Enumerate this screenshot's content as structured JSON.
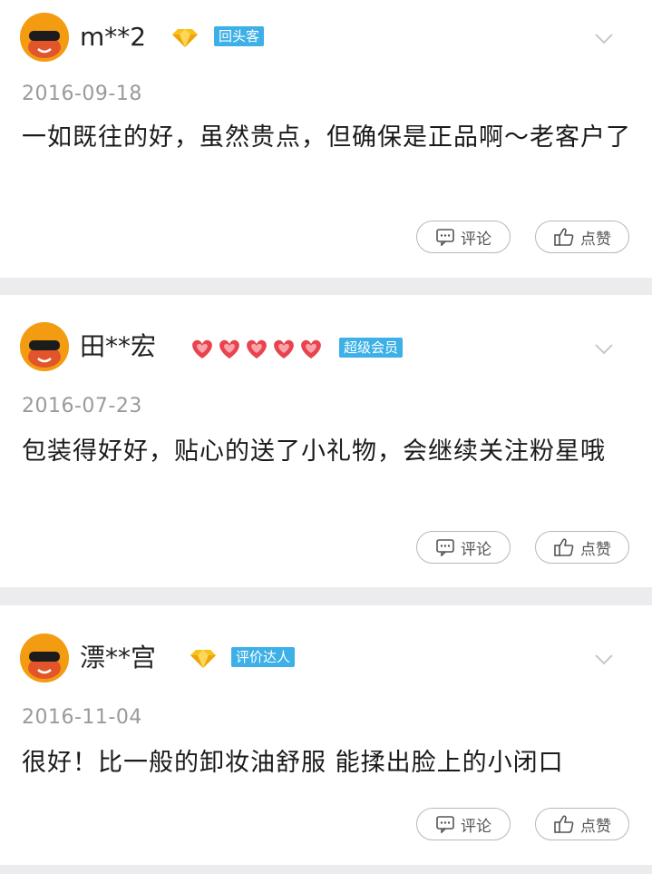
{
  "reviews": [
    {
      "username": "m**2",
      "badge_icon": "diamond-icon",
      "tag": "回头客",
      "date": "2016-09-18",
      "content": "一如既往的好，虽然贵点，但确保是正品啊～老客户了",
      "comment_label": "评论",
      "like_label": "点赞"
    },
    {
      "username": "田**宏",
      "badge_icon": "five-hearts-icon",
      "tag": "超级会员",
      "date": "2016-07-23",
      "content": "包装得好好，贴心的送了小礼物，会继续关注粉星哦",
      "comment_label": "评论",
      "like_label": "点赞"
    },
    {
      "username": "漂**宫",
      "badge_icon": "diamond-icon",
      "tag": "评价达人",
      "date": "2016-11-04",
      "content": "很好！比一般的卸妆油舒服 能揉出脸上的小闭口",
      "comment_label": "评论",
      "like_label": "点赞"
    }
  ],
  "colors": {
    "tag_bg": "#3db0e8",
    "avatar": "#f39c12",
    "page_bg": "#ececef"
  }
}
